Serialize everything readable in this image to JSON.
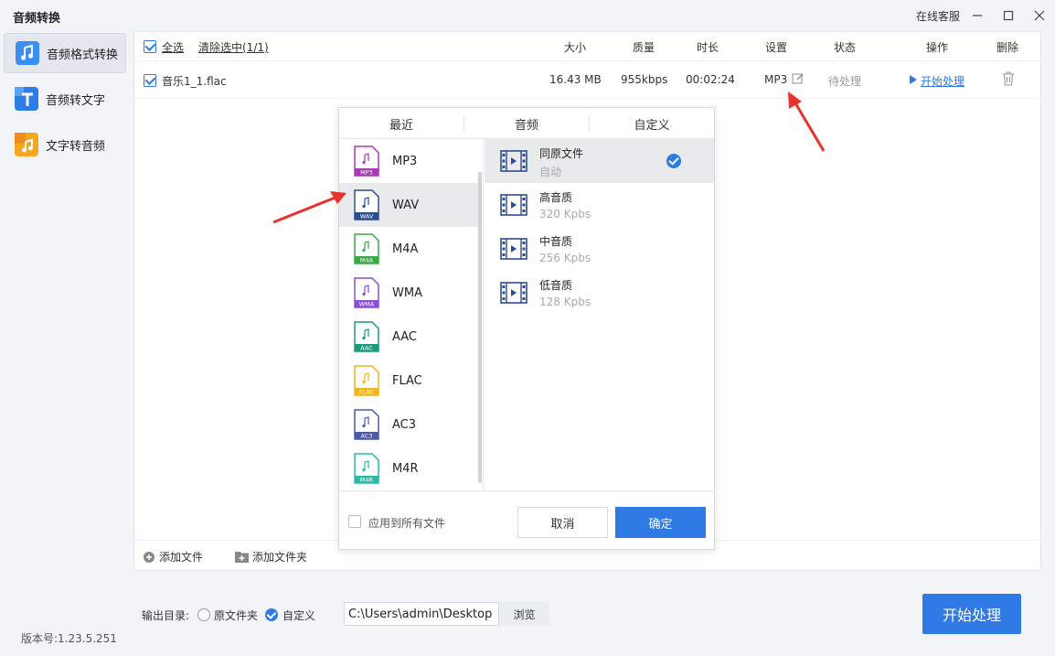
{
  "window": {
    "title": "音频转换",
    "support": "在线客服"
  },
  "sidebar": {
    "items": [
      {
        "label": "音频格式转换",
        "color": "#3a8ef6"
      },
      {
        "label": "音频转文字",
        "color": "#2c7de8"
      },
      {
        "label": "文字转音频",
        "color": "#f5a623"
      }
    ],
    "version": "版本号:1.23.5.251"
  },
  "table": {
    "select_all": "全选",
    "clear_selection": "清除选中(1/1)",
    "headers": {
      "size": "大小",
      "quality": "质量",
      "duration": "时长",
      "settings": "设置",
      "status": "状态",
      "action": "操作",
      "delete": "删除"
    },
    "rows": [
      {
        "name": "音乐1_1.flac",
        "size": "16.43 MB",
        "quality": "955kbps",
        "duration": "00:02:24",
        "format": "MP3",
        "status": "待处理",
        "action": "开始处理"
      }
    ]
  },
  "footer": {
    "add_file": "添加文件",
    "add_folder": "添加文件夹"
  },
  "output": {
    "label": "输出目录:",
    "option_original": "原文件夹",
    "option_custom": "自定义",
    "selected": "custom",
    "path": "C:\\Users\\admin\\Desktop",
    "browse": "浏览",
    "start": "开始处理"
  },
  "popup": {
    "tabs": [
      "最近",
      "音频",
      "自定义"
    ],
    "formats": [
      {
        "name": "MP3",
        "color": "#a83ab7",
        "selected": false
      },
      {
        "name": "WAV",
        "color": "#2e4d8f",
        "selected": true
      },
      {
        "name": "M4A",
        "color": "#3aa845",
        "selected": false
      },
      {
        "name": "WMA",
        "color": "#8a4fd6",
        "selected": false
      },
      {
        "name": "AAC",
        "color": "#1c9a7a",
        "selected": false
      },
      {
        "name": "FLAC",
        "color": "#f5b31c",
        "selected": false
      },
      {
        "name": "AC3",
        "color": "#4a5aa6",
        "selected": false
      },
      {
        "name": "M4R",
        "color": "#2ab8a8",
        "selected": false
      }
    ],
    "qualities": [
      {
        "name": "同原文件",
        "rate": "自动",
        "selected": true
      },
      {
        "name": "高音质",
        "rate": "320 Kpbs",
        "selected": false
      },
      {
        "name": "中音质",
        "rate": "256 Kpbs",
        "selected": false
      },
      {
        "name": "低音质",
        "rate": "128 Kpbs",
        "selected": false
      }
    ],
    "apply_all": "应用到所有文件",
    "cancel": "取消",
    "confirm": "确定"
  },
  "colors": {
    "accent": "#2f7ae5",
    "annotation_arrow": "#e8322d"
  }
}
